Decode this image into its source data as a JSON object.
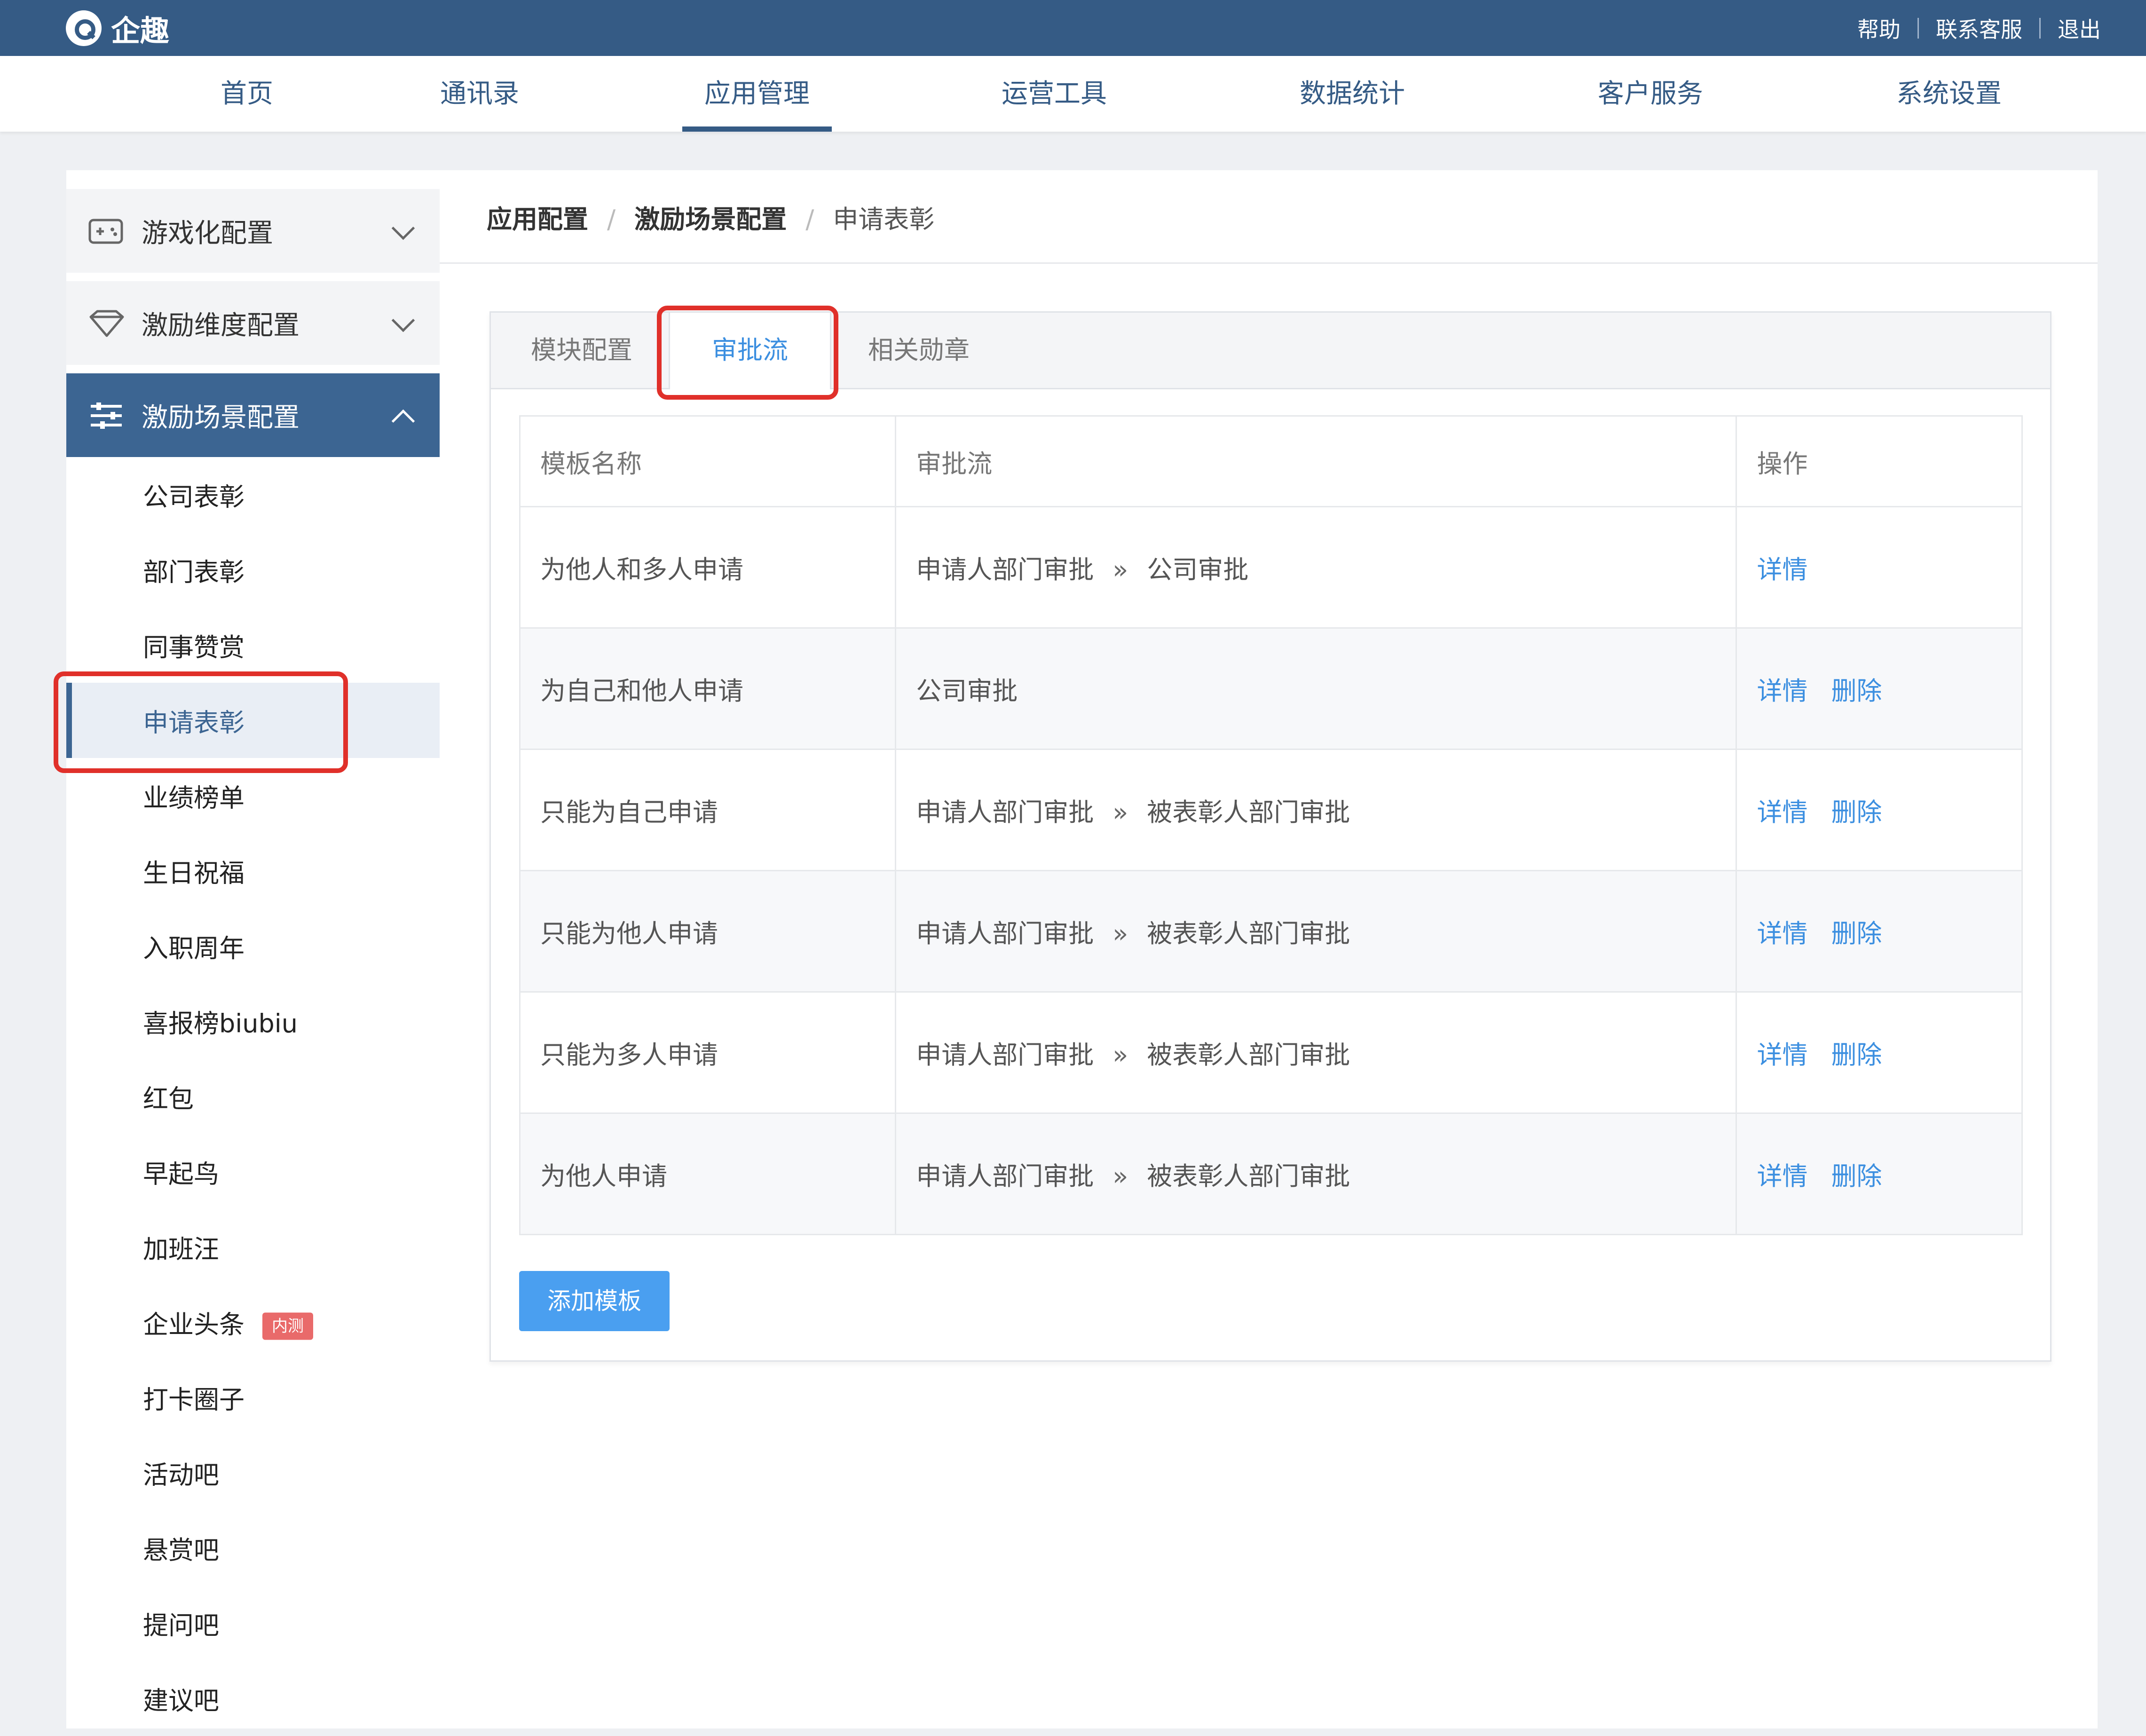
{
  "app": {
    "name": "企趣",
    "logo_icon": "qiqu-logo-icon"
  },
  "top_links": [
    "帮助",
    "联系客服",
    "退出"
  ],
  "nav": {
    "items": [
      "首页",
      "通讯录",
      "应用管理",
      "运营工具",
      "数据统计",
      "客户服务",
      "系统设置"
    ],
    "active": "应用管理"
  },
  "sidebar": {
    "groups": [
      {
        "label": "游戏化配置",
        "icon": "gamepad-icon",
        "expanded": false
      },
      {
        "label": "激励维度配置",
        "icon": "diamond-icon",
        "expanded": false
      },
      {
        "label": "激励场景配置",
        "icon": "sliders-icon",
        "expanded": true
      }
    ],
    "items": [
      "公司表彰",
      "部门表彰",
      "同事赞赏",
      "申请表彰",
      "业绩榜单",
      "生日祝福",
      "入职周年",
      "喜报榜biubiu",
      "红包",
      "早起鸟",
      "加班汪",
      "企业头条",
      "打卡圈子",
      "活动吧",
      "悬赏吧",
      "提问吧",
      "建议吧"
    ],
    "selected": "申请表彰",
    "badge": "内测"
  },
  "breadcrumb": [
    "应用配置",
    "激励场景配置",
    "申请表彰"
  ],
  "tabs": {
    "items": [
      "模块配置",
      "审批流",
      "相关勋章"
    ],
    "active": "审批流"
  },
  "table": {
    "headers": [
      "模板名称",
      "审批流",
      "操作"
    ],
    "rows": [
      {
        "name": "为他人和多人申请",
        "flow": [
          "申请人部门审批",
          "公司审批"
        ],
        "actions": [
          "详情"
        ]
      },
      {
        "name": "为自己和他人申请",
        "flow": [
          "公司审批"
        ],
        "actions": [
          "详情",
          "删除"
        ]
      },
      {
        "name": "只能为自己申请",
        "flow": [
          "申请人部门审批",
          "被表彰人部门审批"
        ],
        "actions": [
          "详情",
          "删除"
        ]
      },
      {
        "name": "只能为他人申请",
        "flow": [
          "申请人部门审批",
          "被表彰人部门审批"
        ],
        "actions": [
          "详情",
          "删除"
        ]
      },
      {
        "name": "只能为多人申请",
        "flow": [
          "申请人部门审批",
          "被表彰人部门审批"
        ],
        "actions": [
          "详情",
          "删除"
        ]
      },
      {
        "name": "为他人申请",
        "flow": [
          "申请人部门审批",
          "被表彰人部门审批"
        ],
        "actions": [
          "详情",
          "删除"
        ]
      }
    ],
    "flow_separator": "»"
  },
  "add_button": "添加模板",
  "colors": {
    "header": "#355b85",
    "accent": "#3c8fe0",
    "highlight": "#e0302a",
    "badge": "#e96a6a"
  }
}
